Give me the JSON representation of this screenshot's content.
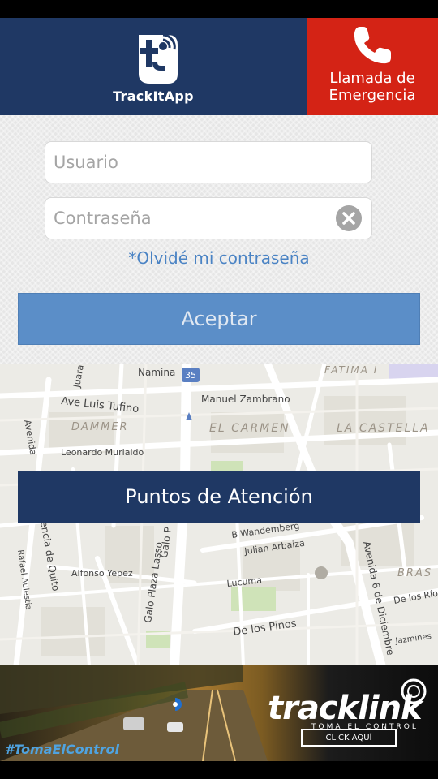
{
  "header": {
    "app_name": "TrackItApp",
    "emergency_label_line1": "Llamada de",
    "emergency_label_line2": "Emergencia"
  },
  "login": {
    "username_placeholder": "Usuario",
    "password_placeholder": "Contraseña",
    "forgot_link": "*Olvidé mi contraseña",
    "accept_button": "Aceptar"
  },
  "map": {
    "labels": [
      "Namina",
      "35",
      "FATIMA I",
      "Ave Luis Tufino",
      "Manuel Zambrano",
      "DAMMER",
      "EL CARMEN",
      "LA CASTELLA",
      "Leonardo Murialdo",
      "Avenida",
      "B Wandemberg",
      "Julian Arbaiza",
      "encia de Quito",
      "Galo Plaza Lasso",
      "Galo P",
      "Alfonso Yepez",
      "Lucuma",
      "Avenida 6 de Diciembre",
      "De los Ríos",
      "De los Pinos",
      "Rafael Aulestia",
      "BRAS",
      "Jazmines",
      "Juara"
    ]
  },
  "puntos_button": "Puntos de Atención",
  "ad": {
    "hashtag": "#TomaElControl",
    "brand": "tracklink",
    "tagline": "TOMA EL CONTROL",
    "cta": "CLICK AQUÍ"
  },
  "colors": {
    "navy": "#1f3864",
    "emergency_red": "#d42315",
    "accept_blue": "#5b8ec8",
    "link_blue": "#4a83c4"
  }
}
